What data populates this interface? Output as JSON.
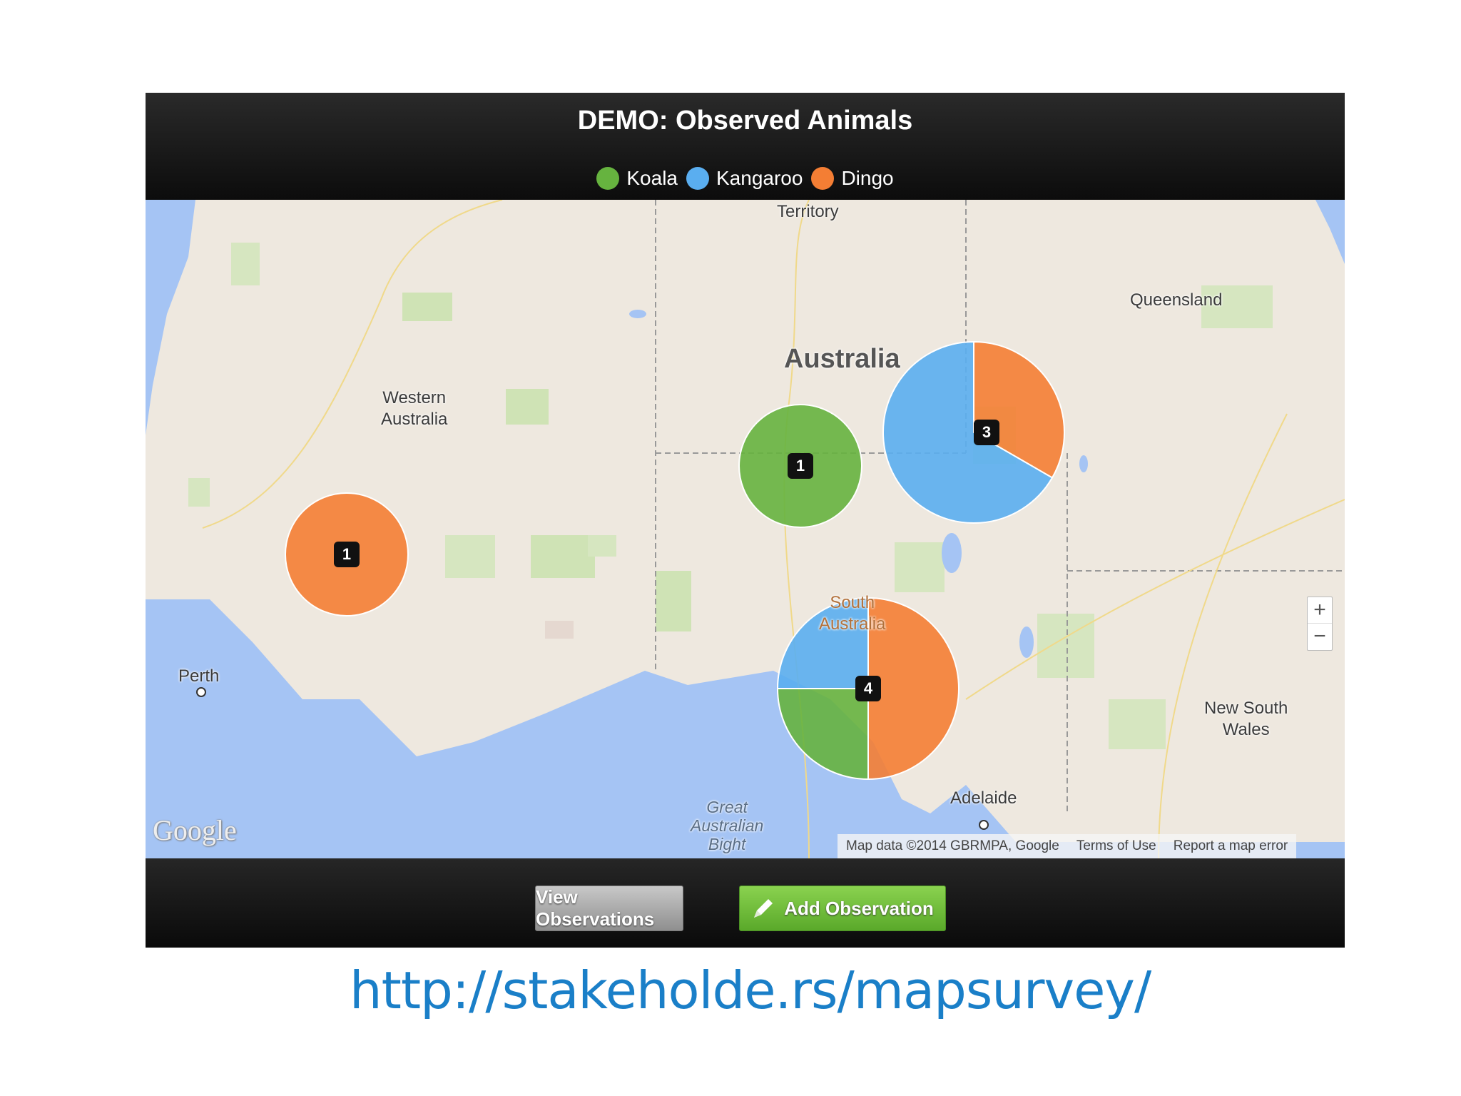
{
  "header": {
    "title": "DEMO: Observed Animals",
    "legend": [
      {
        "label": "Koala",
        "color": "#66b33f"
      },
      {
        "label": "Kangaroo",
        "color": "#5aaef0"
      },
      {
        "label": "Dingo",
        "color": "#f47e34"
      }
    ]
  },
  "map": {
    "labels": {
      "territory": "Territory",
      "queensland": "Queensland",
      "australia": "Australia",
      "western_australia": "Western\nAustralia",
      "south_australia": "South\nAustralia",
      "perth": "Perth",
      "nsw": "New South\nWales",
      "adelaide": "Adelaide",
      "bight": "Great\nAustralian\nBight"
    },
    "clusters": [
      {
        "count": "1",
        "koala": 0,
        "kangaroo": 0,
        "dingo": 1
      },
      {
        "count": "1",
        "koala": 1,
        "kangaroo": 0,
        "dingo": 0
      },
      {
        "count": "3",
        "koala": 0,
        "kangaroo": 2,
        "dingo": 1
      },
      {
        "count": "4",
        "koala": 1,
        "kangaroo": 1,
        "dingo": 2
      }
    ],
    "zoom_in": "+",
    "zoom_out": "−",
    "logo": "Google",
    "attribution": {
      "map_data": "Map data ©2014 GBRMPA, Google",
      "terms": "Terms of Use",
      "report": "Report a map error"
    }
  },
  "footer": {
    "view_label": "View Observations",
    "add_label": "Add Observation"
  },
  "url": "http://stakeholde.rs/mapsurvey/"
}
